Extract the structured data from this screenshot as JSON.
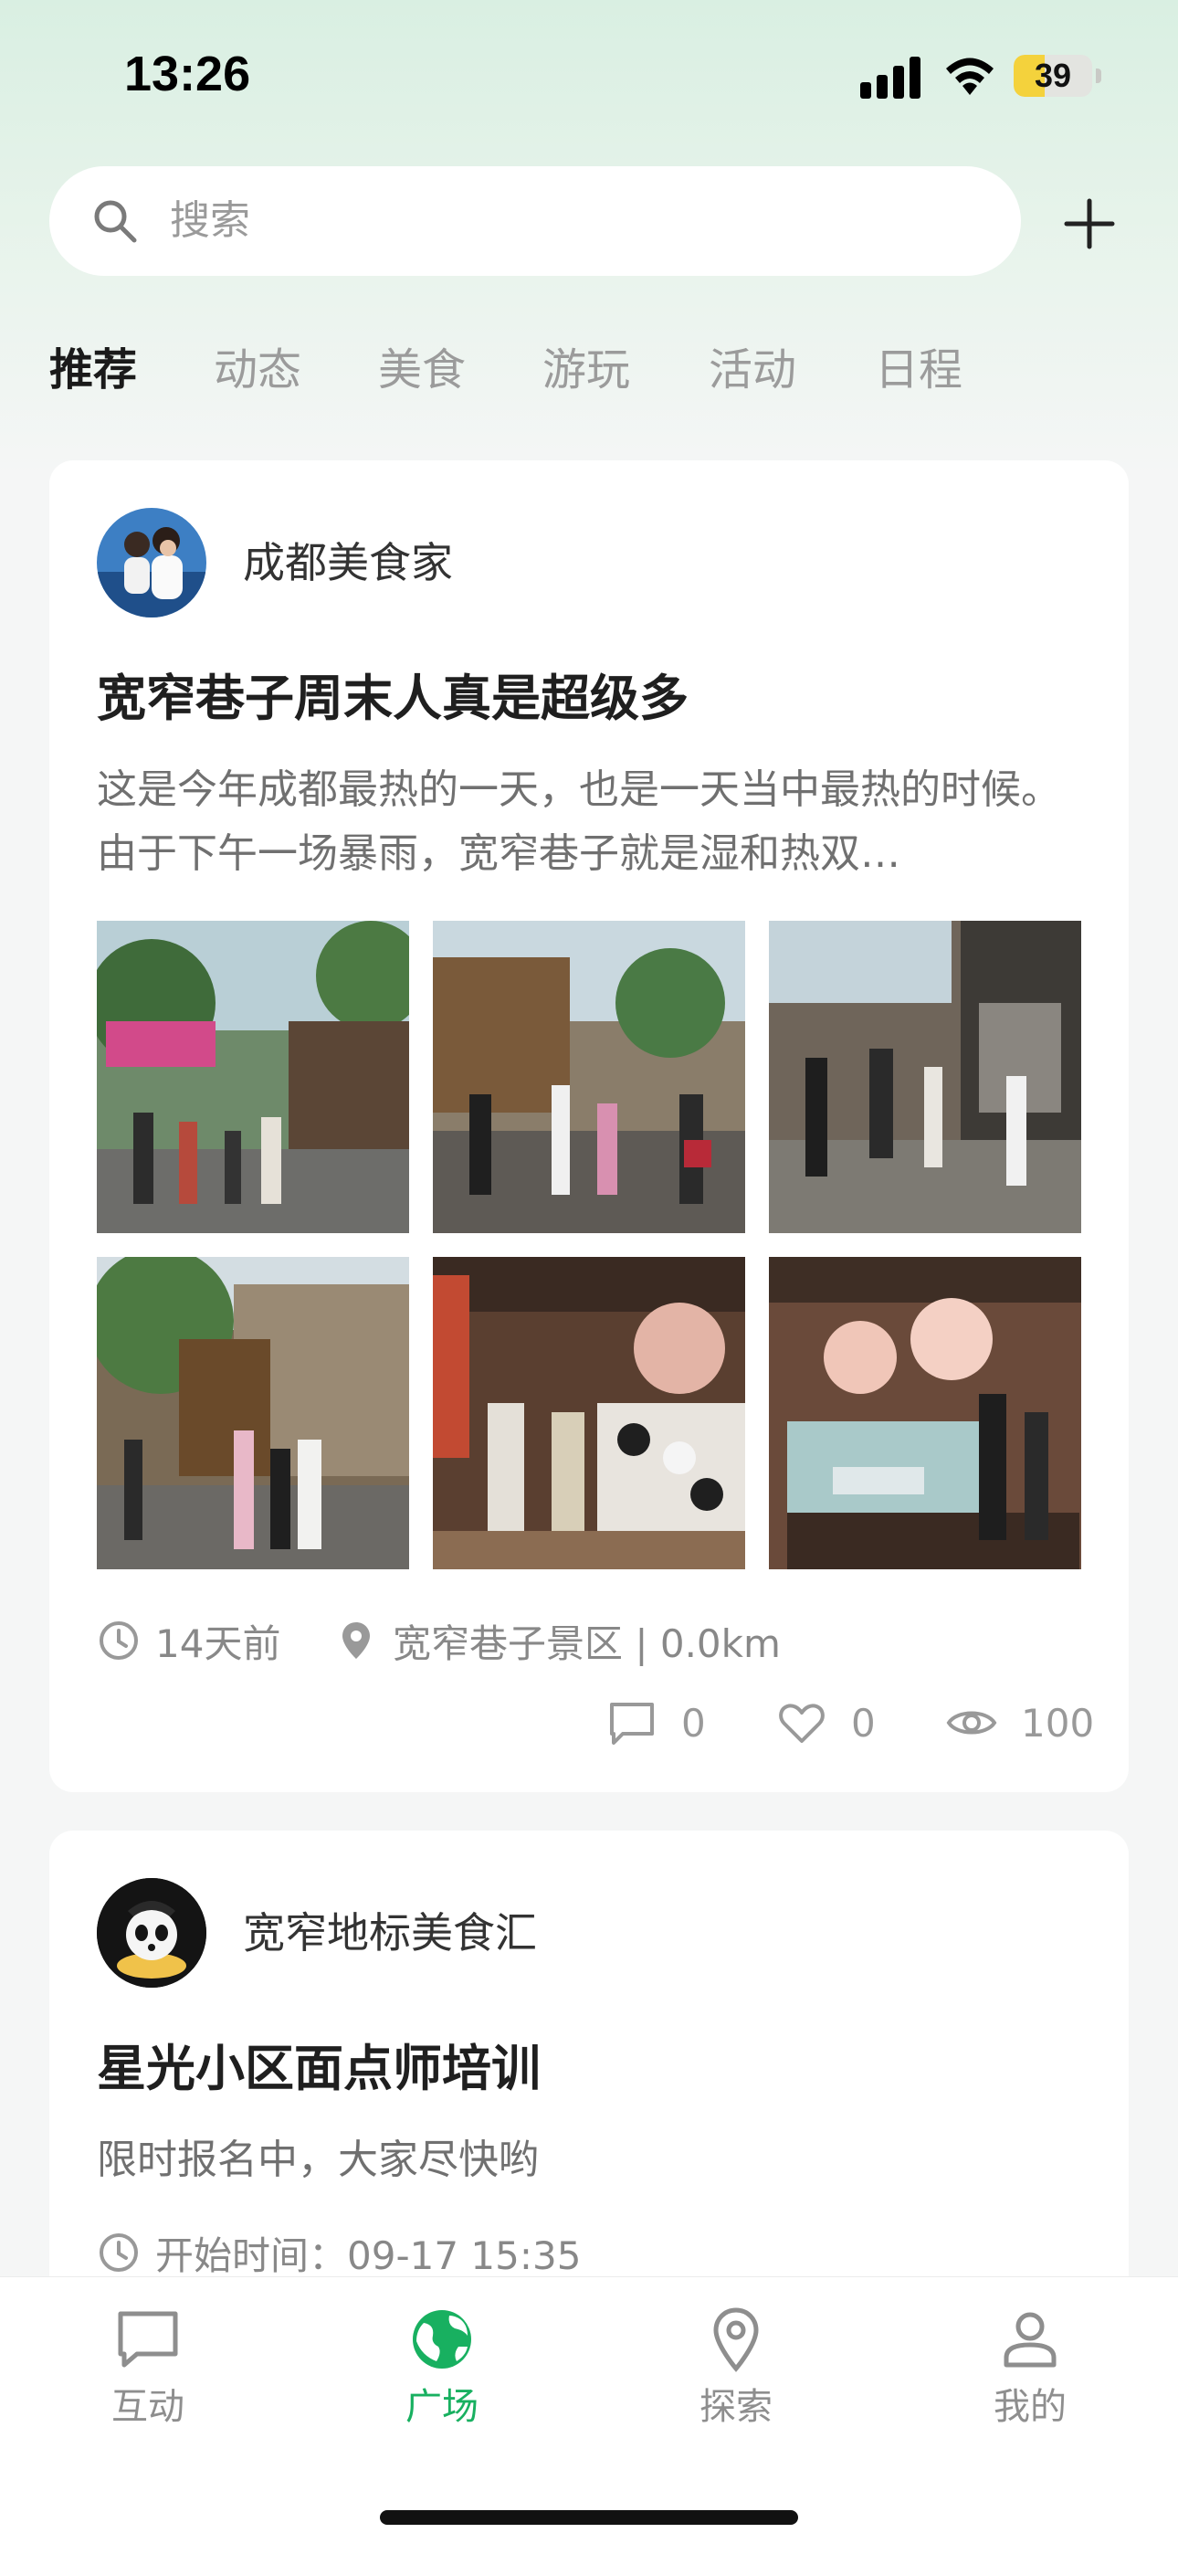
{
  "status_bar": {
    "time": "13:26",
    "battery": "39",
    "battery_level": 0.39
  },
  "search": {
    "placeholder": "搜索"
  },
  "tabs": [
    {
      "label": "推荐",
      "active": true
    },
    {
      "label": "动态",
      "active": false
    },
    {
      "label": "美食",
      "active": false
    },
    {
      "label": "游玩",
      "active": false
    },
    {
      "label": "活动",
      "active": false
    },
    {
      "label": "日程",
      "active": false
    }
  ],
  "posts": [
    {
      "author": "成都美食家",
      "title": "宽窄巷子周末人真是超级多",
      "excerpt": "这是今年成都最热的一天，也是一天当中最热的时候。由于下午一场暴雨，宽窄巷子就是湿和热双…",
      "photos": [
        "street-photo-1",
        "street-photo-2",
        "street-photo-3",
        "street-photo-4",
        "shop-photo-5",
        "shop-photo-6"
      ],
      "time": "14天前",
      "location": "宽窄巷子景区 | 0.0km",
      "comments": "0",
      "likes": "0",
      "views": "100"
    },
    {
      "author": "宽窄地标美食汇",
      "title": "星光小区面点师培训",
      "excerpt": "限时报名中，大家尽快哟",
      "start_time": "开始时间：09-17 15:35"
    }
  ],
  "bottom_nav": [
    {
      "label": "互动",
      "icon": "chat-bubble-icon",
      "active": false
    },
    {
      "label": "广场",
      "icon": "globe-icon",
      "active": true
    },
    {
      "label": "探索",
      "icon": "location-pin-icon",
      "active": false
    },
    {
      "label": "我的",
      "icon": "person-icon",
      "active": false
    }
  ],
  "colors": {
    "accent": "#18b060",
    "header_bg": "#d9efe2"
  }
}
